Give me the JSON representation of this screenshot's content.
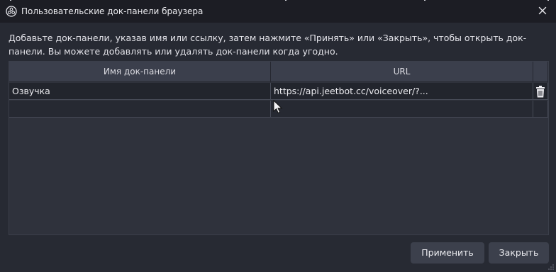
{
  "window": {
    "title": "Пользовательские док-панели браузера"
  },
  "description": "Добавьте док-панели, указав имя или ссылку, затем нажмите «Принять» или «Закрыть», чтобы открыть док-панели. Вы можете добавлять или удалять док-панели когда угодно.",
  "table": {
    "columns": [
      "Имя док-панели",
      "URL"
    ],
    "rows": [
      {
        "name": "Озвучка",
        "url": "https://api.jeetbot.cc/voiceover/?..."
      },
      {
        "name": "",
        "url": ""
      }
    ]
  },
  "buttons": {
    "apply": "Применить",
    "close": "Закрыть"
  },
  "icons": {
    "app": "obs-logo-icon",
    "close": "close-icon",
    "delete": "trash-icon"
  },
  "colors": {
    "background": "#272a33",
    "titlebar": "#1c1d24",
    "button": "#3c404c"
  }
}
